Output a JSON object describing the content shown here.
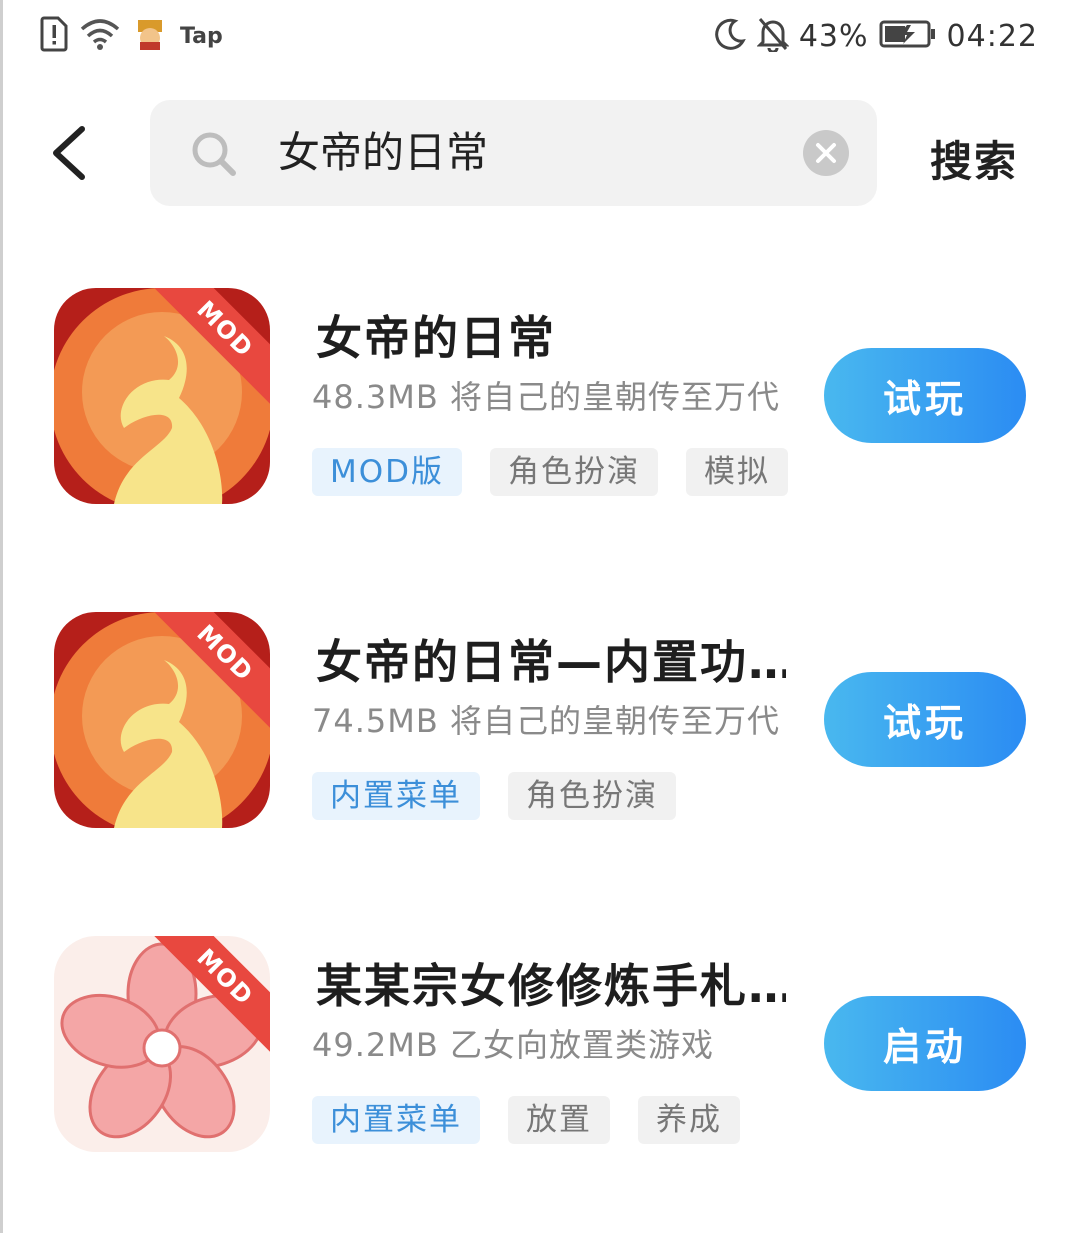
{
  "status_bar": {
    "tap_label": "Tap",
    "battery_percent": "43%",
    "time": "04:22",
    "icons": [
      "sim-alert-icon",
      "wifi-icon",
      "app-notification-icon",
      "moon-icon",
      "bell-off-icon",
      "battery-charging-icon"
    ]
  },
  "search": {
    "value": "女帝的日常",
    "button_label": "搜索"
  },
  "results": [
    {
      "title": "女帝的日常",
      "desc": "48.3MB 将自己的皇朝传至万代",
      "badge": "MOD",
      "tags": [
        {
          "label": "MOD版",
          "accent": true
        },
        {
          "label": "角色扮演",
          "accent": false
        },
        {
          "label": "模拟",
          "accent": false
        }
      ],
      "action": "试玩"
    },
    {
      "title": "女帝的日常—内置功…",
      "desc": "74.5MB 将自己的皇朝传至万代",
      "badge": "MOD",
      "tags": [
        {
          "label": "内置菜单",
          "accent": true
        },
        {
          "label": "角色扮演",
          "accent": false
        }
      ],
      "action": "试玩"
    },
    {
      "title": "某某宗女修修炼手札…",
      "desc": "49.2MB 乙女向放置类游戏",
      "badge": "MOD",
      "tags": [
        {
          "label": "内置菜单",
          "accent": true
        },
        {
          "label": "放置",
          "accent": false
        },
        {
          "label": "养成",
          "accent": false
        }
      ],
      "action": "启动"
    }
  ],
  "colors": {
    "accent_blue": "#2b8cf3",
    "tag_accent_bg": "#e8f3fd",
    "tag_accent_text": "#3c8fd9",
    "mod_red": "#e8483f"
  }
}
